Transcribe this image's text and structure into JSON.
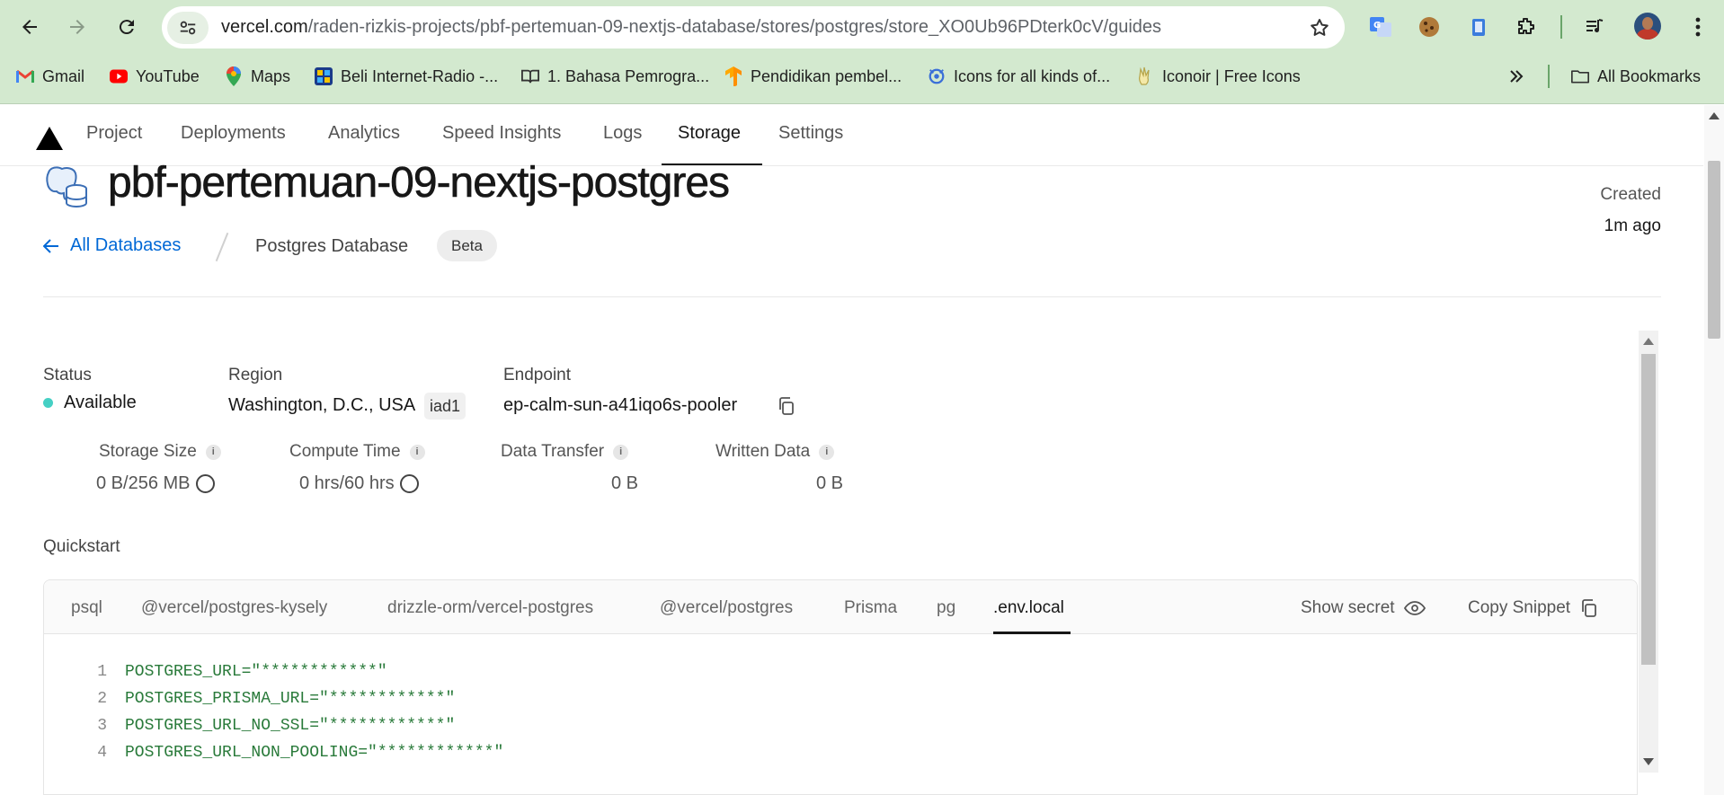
{
  "browser": {
    "url_host": "vercel.com",
    "url_path": "/raden-rizkis-projects/pbf-pertemuan-09-nextjs-database/stores/postgres/store_XO0Ub96PDterk0cV/guides",
    "bookmarks": [
      {
        "label": "Gmail",
        "icon": "gmail-icon"
      },
      {
        "label": "YouTube",
        "icon": "youtube-icon"
      },
      {
        "label": "Maps",
        "icon": "maps-icon"
      },
      {
        "label": "Beli Internet-Radio -...",
        "icon": "radio-icon"
      },
      {
        "label": "1. Bahasa Pemrogra...",
        "icon": "book-icon"
      },
      {
        "label": "Pendidikan pembel...",
        "icon": "tensorflow-icon"
      },
      {
        "label": "Icons for all kinds of...",
        "icon": "icons-icon"
      },
      {
        "label": "Iconoir | Free Icons",
        "icon": "iconoir-icon"
      }
    ],
    "all_bookmarks": "All Bookmarks"
  },
  "nav": {
    "tabs": [
      "Project",
      "Deployments",
      "Analytics",
      "Speed Insights",
      "Logs",
      "Storage",
      "Settings"
    ],
    "active": "Storage"
  },
  "header": {
    "title": "pbf-pertemuan-09-nextjs-postgres",
    "back_label": "All Databases",
    "db_type": "Postgres Database",
    "badge": "Beta",
    "created_label": "Created",
    "created_value": "1m ago"
  },
  "info": {
    "status_label": "Status",
    "status_value": "Available",
    "region_label": "Region",
    "region_value": "Washington, D.C., USA",
    "region_code": "iad1",
    "endpoint_label": "Endpoint",
    "endpoint_value": "ep-calm-sun-a41iqo6s-pooler"
  },
  "metrics": [
    {
      "label": "Storage Size",
      "value": "0 B/256 MB"
    },
    {
      "label": "Compute Time",
      "value": "0 hrs/60 hrs"
    },
    {
      "label": "Data Transfer",
      "value": "0 B"
    },
    {
      "label": "Written Data",
      "value": "0 B"
    }
  ],
  "quickstart": {
    "title": "Quickstart",
    "tabs": [
      "psql",
      "@vercel/postgres-kysely",
      "drizzle-orm/vercel-postgres",
      "@vercel/postgres",
      "Prisma",
      "pg",
      ".env.local"
    ],
    "active_tab": ".env.local",
    "show_secret": "Show secret",
    "copy_snippet": "Copy Snippet",
    "lines": [
      {
        "n": "1",
        "text": "POSTGRES_URL=\"************\""
      },
      {
        "n": "2",
        "text": "POSTGRES_PRISMA_URL=\"************\""
      },
      {
        "n": "3",
        "text": "POSTGRES_URL_NO_SSL=\"************\""
      },
      {
        "n": "4",
        "text": "POSTGRES_URL_NON_POOLING=\"************\""
      }
    ]
  },
  "colors": {
    "status_available": "#45d0c4",
    "link": "#0068d6",
    "code_green": "#297a3a",
    "chrome_bg": "#d3e9cf"
  }
}
